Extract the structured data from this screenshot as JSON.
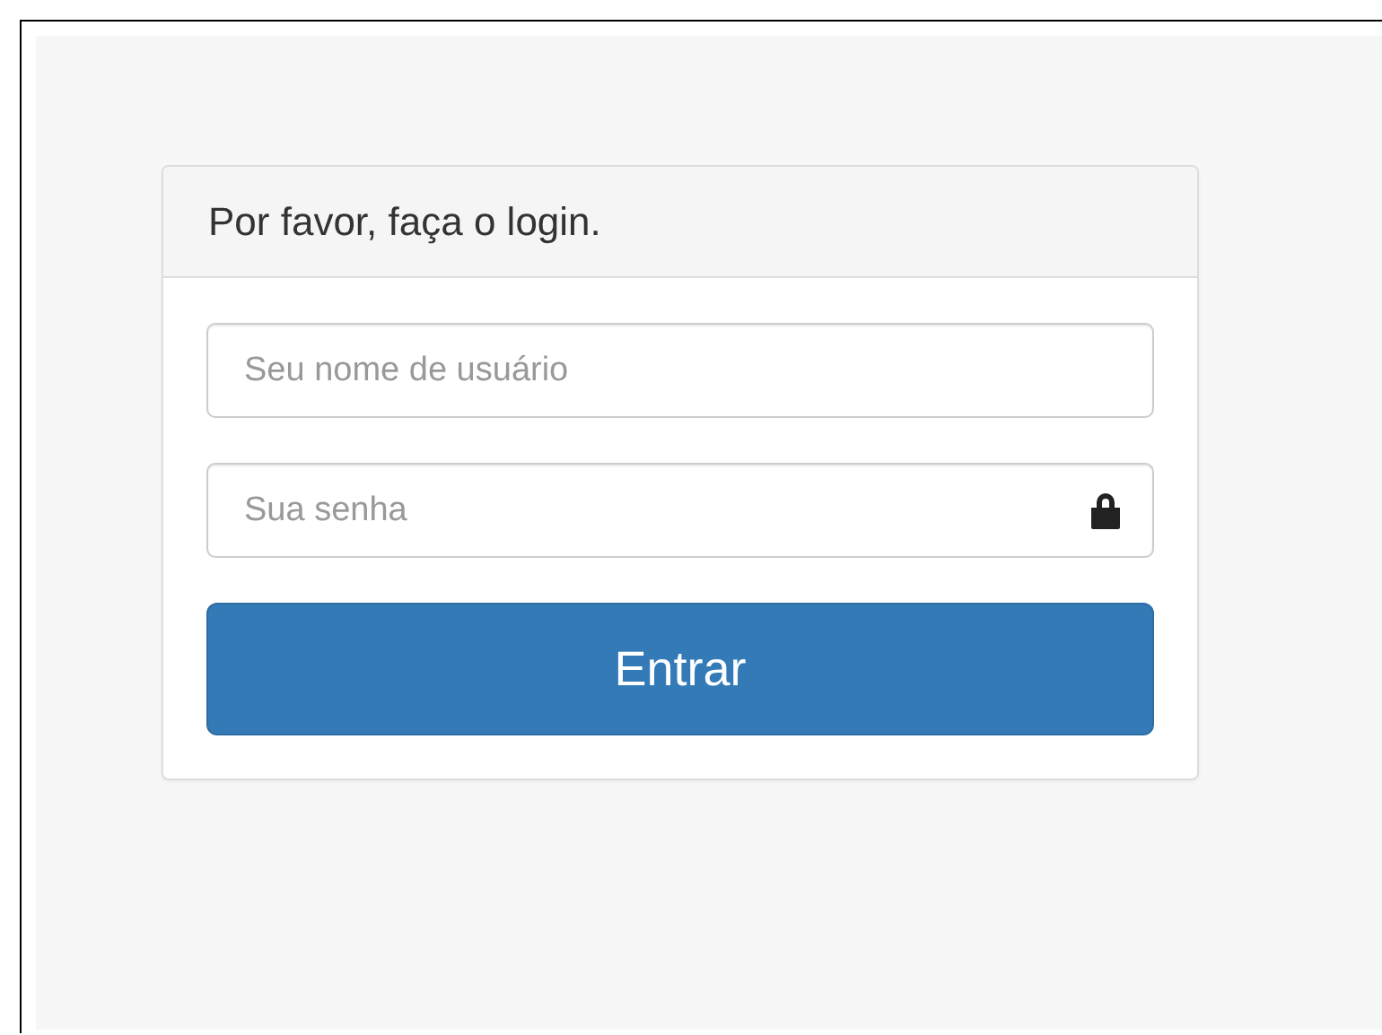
{
  "panel": {
    "title": "Por favor, faça o login."
  },
  "fields": [
    {
      "kind": "text",
      "placeholder": "Seu nome de usuário"
    },
    {
      "kind": "password",
      "placeholder": "Sua senha"
    }
  ],
  "button": {
    "label": "Entrar"
  }
}
